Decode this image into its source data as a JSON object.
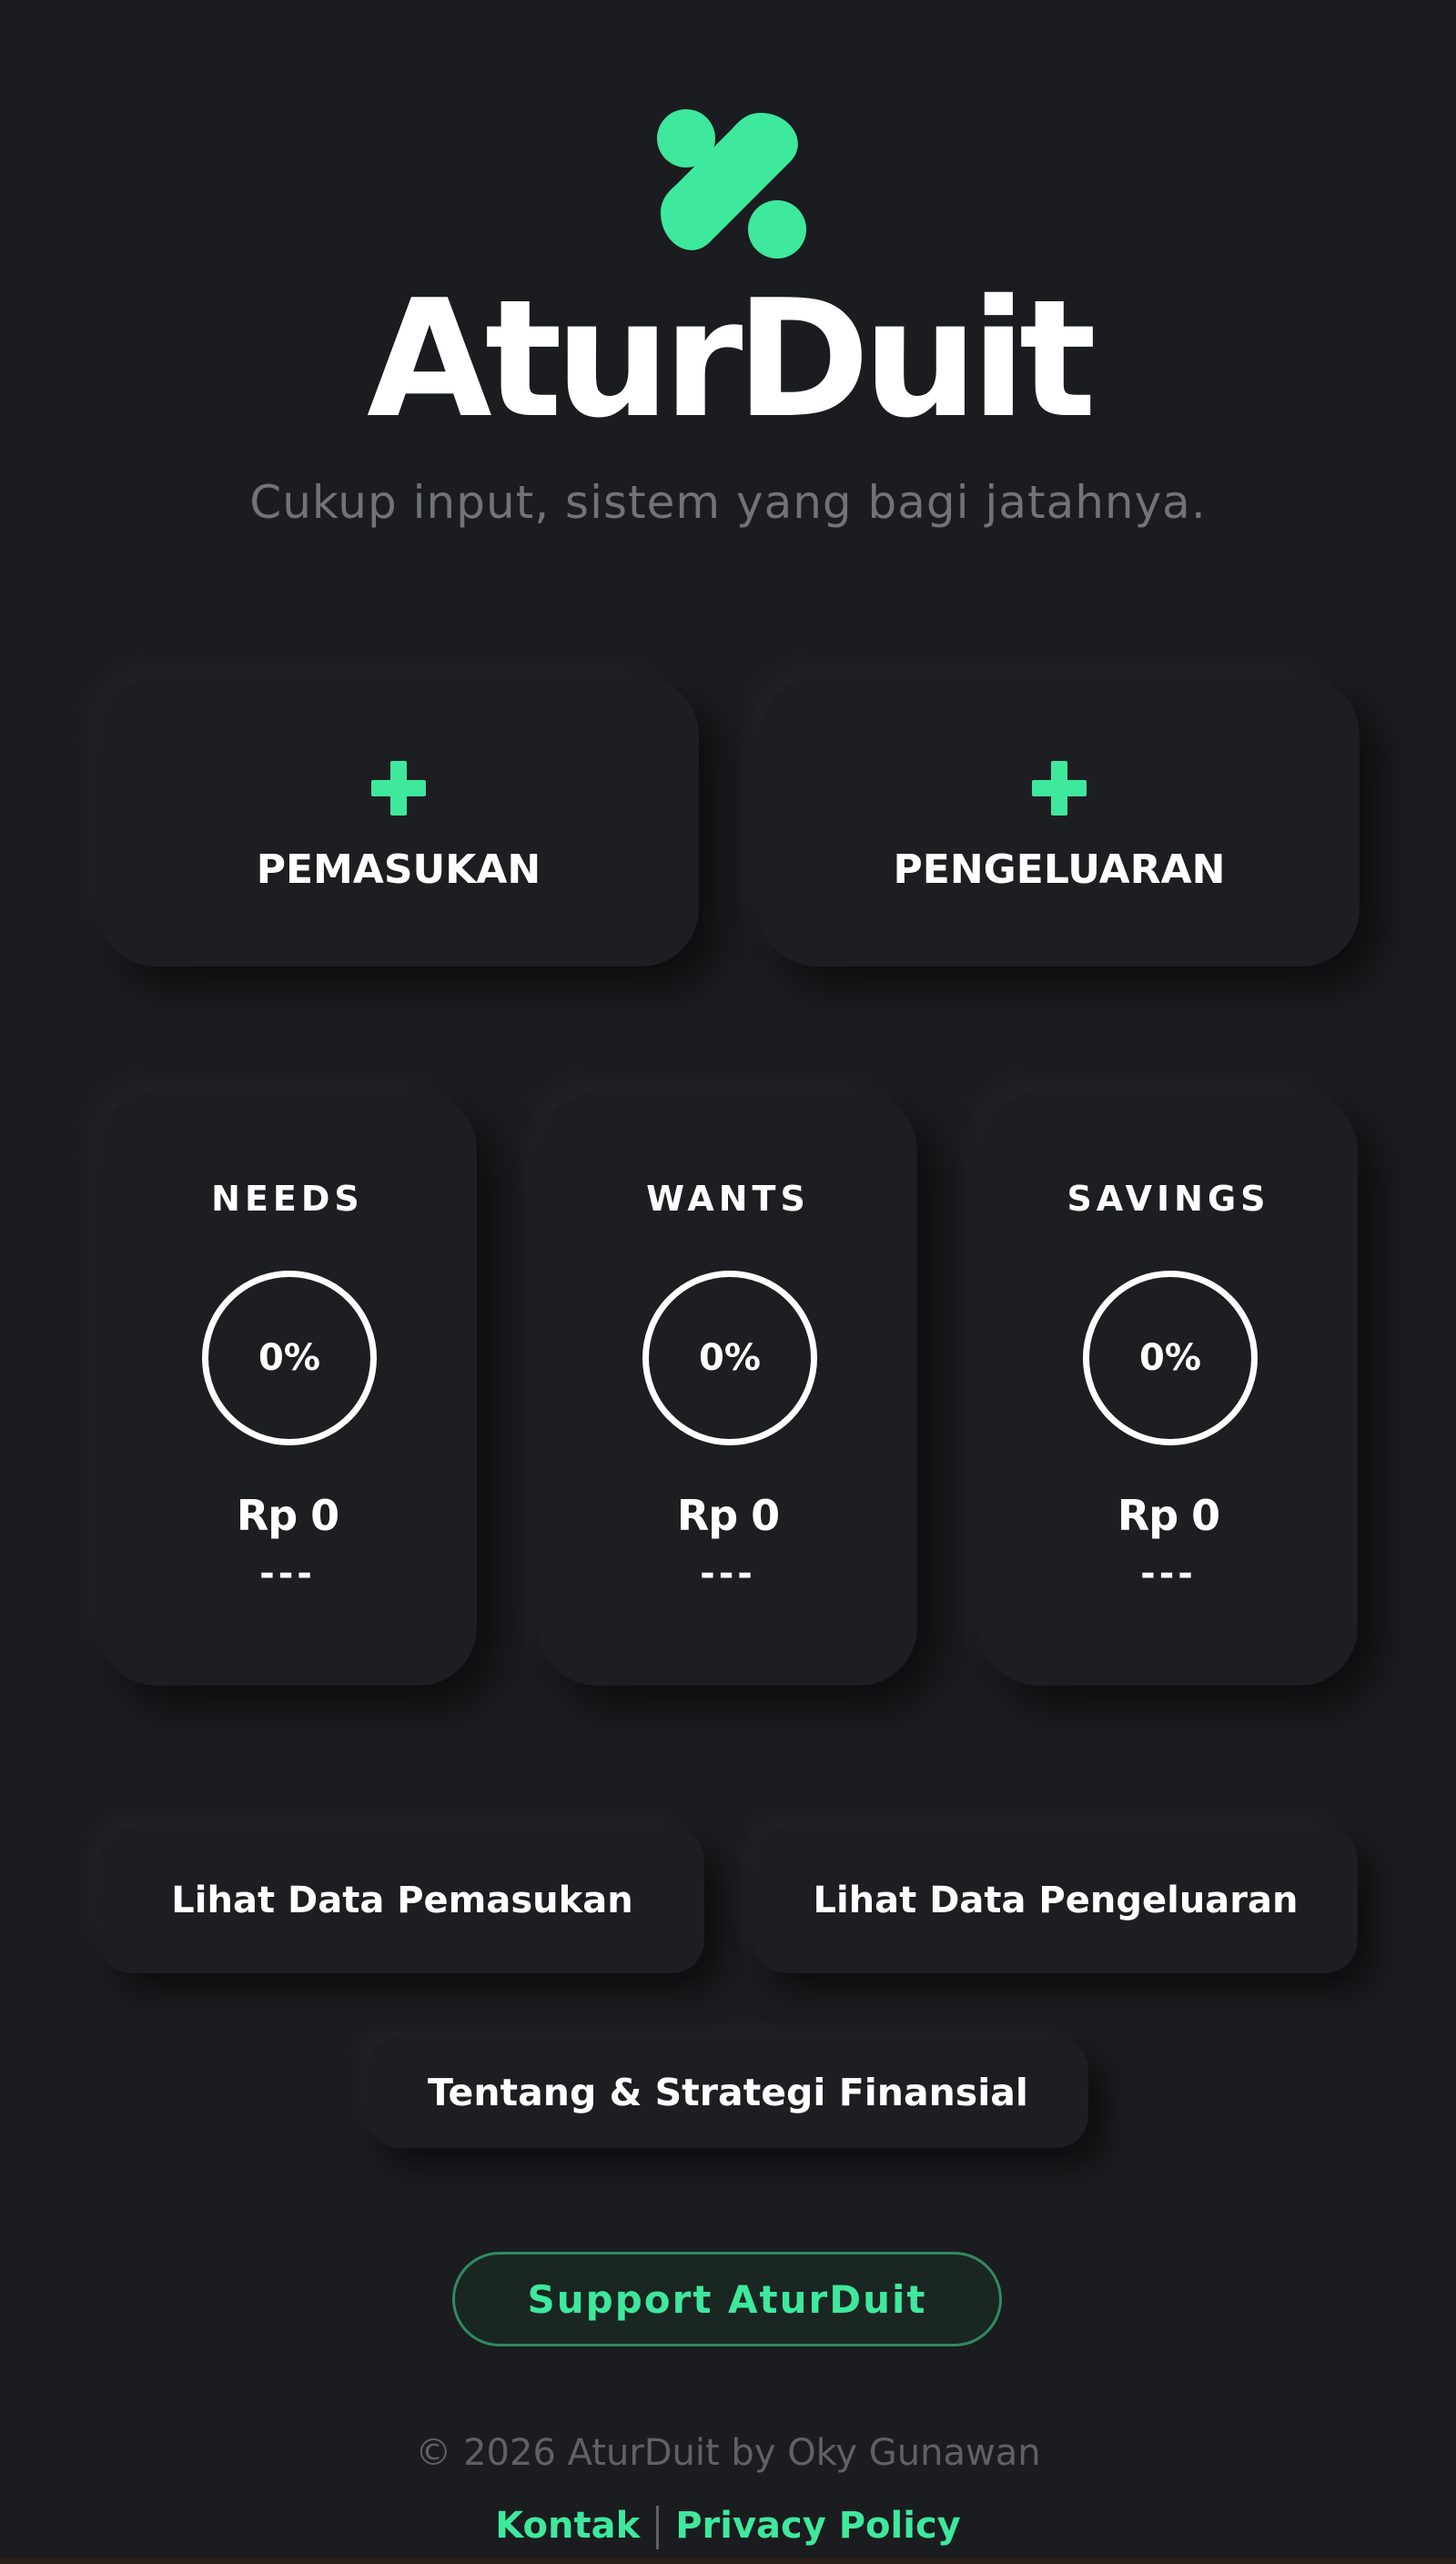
{
  "brand": {
    "name": "AturDuit",
    "tagline": "Cukup input, sistem yang bagi jatahnya.",
    "accent_color": "#3ee89d",
    "logo_icon": "percent-icon"
  },
  "actions": {
    "income": {
      "label": "PEMASUKAN",
      "icon": "plus-icon"
    },
    "expense": {
      "label": "PENGELUARAN",
      "icon": "plus-icon"
    }
  },
  "categories": [
    {
      "title": "NEEDS",
      "percent": "0%",
      "amount": "Rp 0",
      "sub": "---"
    },
    {
      "title": "WANTS",
      "percent": "0%",
      "amount": "Rp 0",
      "sub": "---"
    },
    {
      "title": "SAVINGS",
      "percent": "0%",
      "amount": "Rp 0",
      "sub": "---"
    }
  ],
  "buttons": {
    "view_income": "Lihat Data Pemasukan",
    "view_expense": "Lihat Data Pengeluaran",
    "about": "Tentang & Strategi Finansial",
    "support": "Support AturDuit"
  },
  "footer": {
    "copyright": "© 2026 AturDuit by Oky Gunawan",
    "contact": "Kontak",
    "privacy": "Privacy Policy"
  }
}
